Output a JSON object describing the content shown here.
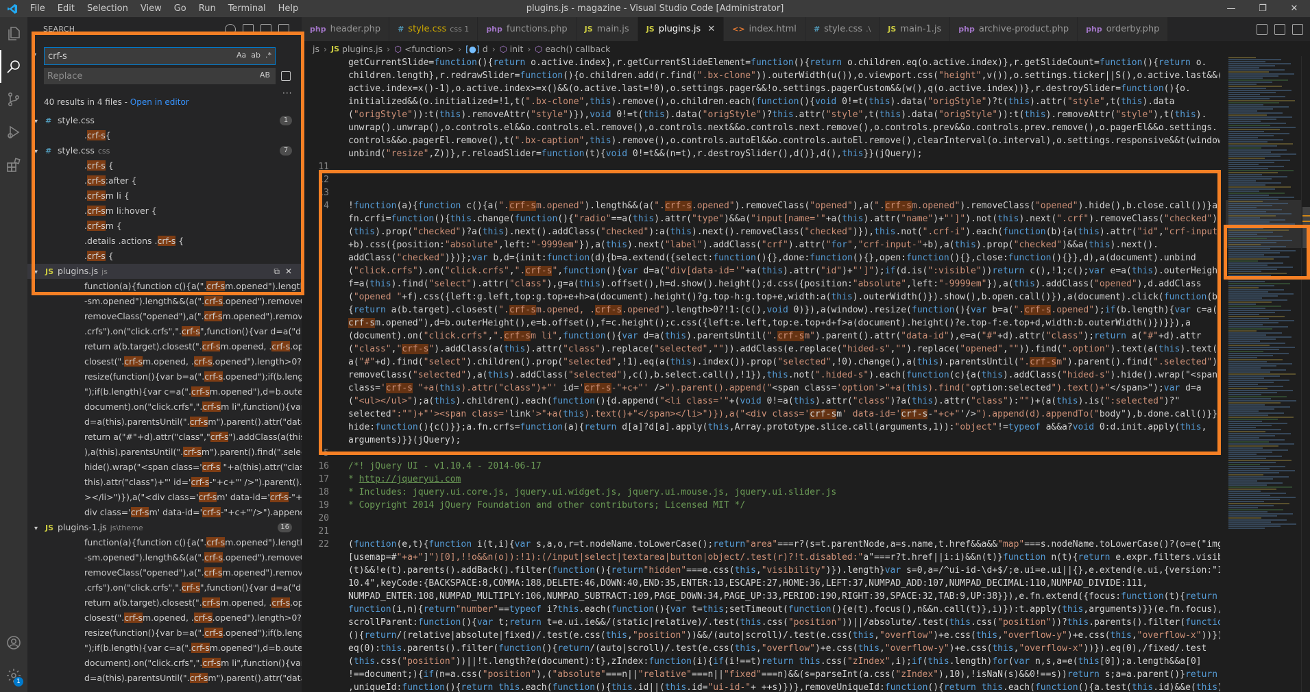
{
  "window": {
    "title": "plugins.js - magazine - Visual Studio Code [Administrator]",
    "menu": [
      "File",
      "Edit",
      "Selection",
      "View",
      "Go",
      "Run",
      "Terminal",
      "Help"
    ],
    "controls": [
      "—",
      "❐",
      "✕"
    ]
  },
  "activity_bar": {
    "items": [
      "files-icon",
      "search-icon",
      "source-control-icon",
      "run-debug-icon",
      "extensions-icon"
    ],
    "bottom": [
      "account-icon",
      "manage-gear-icon"
    ],
    "gear_badge": "1"
  },
  "search": {
    "header": "SEARCH",
    "query": "crf-s",
    "query_options": [
      "Aa",
      "ab",
      ".*"
    ],
    "replace_placeholder": "Replace",
    "replace_option": "AB",
    "summary": "40 results in 4 files - ",
    "open_in_editor": "Open in editor",
    "files": [
      {
        "name": "style.css",
        "type": "css",
        "icon": "#",
        "path": "",
        "count": "1",
        "matches": [
          ".crf-s{"
        ]
      },
      {
        "name": "style.css",
        "type": "css",
        "icon": "#",
        "path": "css",
        "count": "7",
        "matches": [
          ".crf-s {",
          ".crf-s:after {",
          ".crf-sm li {",
          ".crf-sm li:hover {",
          ".crf-sm {",
          ".details .actions .crf-s {",
          ".crf-s {"
        ]
      },
      {
        "name": "plugins.js",
        "type": "js",
        "icon": "JS",
        "path": "js",
        "count": "",
        "matches": [
          "function(a){function c(){a(\".crf-sm.opened\").length&&a(\".crf",
          "-sm.opened\").length&&(a(\".crf-s.opened\").removeClass(\"ope...",
          "removeClass(\"opened\"),a(\".crf-sm.opened\").removeClass(\"op...",
          ".crfs\").on(\"click.crfs\",\".crf-s\",function(){var d=a(\"div[data-id=\"...",
          "return a(b.target).closest(\".crf-sm.opened, .crf-s.opened\").len...",
          "closest(\".crf-sm.opened, .crf-s.opened\").length>0?!1:(c(),void...",
          "resize(function(){var b=a(\".crf-s.opened\");if(b.length){var c=a...",
          "\");if(b.length){var c=a(\".crf-sm.opened\"),d=b.outerHeight(),e...",
          "document).on(\"click.crfs\",\".crf-sm li\",function(){var d=a(this)...",
          "d=a(this).parentsUntil(\".crf-sm\").parent().attr(\"data-id\")=a(\"...",
          "return a(\"#\"+d).attr(\"class\",\"crf-s\").addClass(a(this).attr(\"class...",
          "),a(this).parentsUntil(\".crf-sm\").parent().find(\".selected\").rem...",
          "hide().wrap(\"<span class='crf-s \"+a(this).attr(\"class\")+\"' id='c...",
          "this).attr(\"class\")+\"' id='crf-s-\"+c+\"' />\").parent().append(\"<s...",
          "></li>\")}),a(\"<div class='crf-sm' data-id='crf-s-\"+c+\"'/>\")).ap...",
          "div class='crf-sm' data-id='crf-s-\"+c+\"'/>\").append(d).appen..."
        ]
      },
      {
        "name": "plugins-1.js",
        "type": "js",
        "icon": "JS",
        "path": "js\\theme",
        "count": "16",
        "matches": [
          "function(a){function c(){a(\".crf-sm.opened\").length&&a(\".cr...",
          "-sm.opened\").length&&(a(\".crf-s.opened\").removeClass(\"ope...",
          "removeClass(\"opened\"),a(\".crf-sm.opened\").removeClass(\"op...",
          ".crfs\").on(\"click.crfs\",\".crf-s\",function(){var d=a(\"div[data-id=\"...",
          "return a(b.target).closest(\".crf-sm.opened, .crf-s.opened\").len...",
          "closest(\".crf-sm.opened, .crf-s.opened\").length>0?!1:(c(),void...",
          "resize(function(){var b=a(\".crf-s.opened\");if(b.length){var c=a...",
          "\");if(b.length){var c=a(\".crf-sm.opened\"),d=b.outerHeight(),e...",
          "document).on(\"click.crfs\",\".crf-sm li\",function(){var d=a(this)...",
          "d=a(this).parentsUntil(\".crf-sm\").parent().attr(\"data-id\")=a(\"..."
        ]
      }
    ]
  },
  "tabs": [
    {
      "label": "header.php",
      "type": "php",
      "icon": "php",
      "sub": "",
      "active": false,
      "modified": false
    },
    {
      "label": "style.css",
      "type": "css",
      "icon": "#",
      "sub": "css 1",
      "active": false,
      "modified": true
    },
    {
      "label": "functions.php",
      "type": "php",
      "icon": "php",
      "sub": "",
      "active": false,
      "modified": false
    },
    {
      "label": "main.js",
      "type": "js",
      "icon": "JS",
      "sub": "",
      "active": false,
      "modified": false
    },
    {
      "label": "plugins.js",
      "type": "js",
      "icon": "JS",
      "sub": "",
      "active": true,
      "modified": false
    },
    {
      "label": "index.html",
      "type": "html",
      "icon": "<>",
      "sub": "",
      "active": false,
      "modified": false
    },
    {
      "label": "style.css",
      "type": "css",
      "icon": "#",
      "sub": ".\\",
      "active": false,
      "modified": false
    },
    {
      "label": "main-1.js",
      "type": "js",
      "icon": "JS",
      "sub": "",
      "active": false,
      "modified": false
    },
    {
      "label": "archive-product.php",
      "type": "php",
      "icon": "php",
      "sub": "",
      "active": false,
      "modified": false
    },
    {
      "label": "orderby.php",
      "type": "php",
      "icon": "php",
      "sub": "",
      "active": false,
      "modified": false
    }
  ],
  "breadcrumbs": {
    "folder": "js",
    "file_icon": "JS",
    "file": "plugins.js",
    "items": [
      {
        "icon": "⬡",
        "label": "<function>"
      },
      {
        "icon": "[●]",
        "label": "d"
      },
      {
        "icon": "⬡",
        "label": "init"
      },
      {
        "icon": "⬡",
        "label": "each() callback"
      }
    ]
  },
  "code": {
    "lines": [
      {
        "n": "",
        "t": "getCurrentSlide=function(){return o.active.index},r.getCurrentSlideElement=function(){return o.children.eq(o.active.index)},r.getSlideCount=function(){return o."
      },
      {
        "n": "",
        "t": "children.length},r.redrawSlider=function(){o.children.add(r.find(\".bx-clone\")).outerWidth(u()),o.viewport.css(\"height\",v()),o.settings.ticker||S(),o.active.last&&(o."
      },
      {
        "n": "",
        "t": "active.index=x()-1),o.active.index>=x()&&(o.active.last=!0),o.settings.pager&&!o.settings.pagerCustom&&(w(),q(o.active.index))},r.destroySlider=function(){o."
      },
      {
        "n": "",
        "t": "initialized&&(o.initialized=!1,t(\".bx-clone\",this).remove(),o.children.each(function(){void 0!=t(this).data(\"origStyle\")?t(this).attr(\"style\",t(this).data"
      },
      {
        "n": "",
        "t": "(\"origStyle\")):t(this).removeAttr(\"style\")}),void 0!=t(this).data(\"origStyle\")?this.attr(\"style\",t(this).data(\"origStyle\")):t(this).removeAttr(\"style\"),t(this)."
      },
      {
        "n": "",
        "t": "unwrap().unwrap(),o.controls.el&&o.controls.el.remove(),o.controls.next&&o.controls.next.remove(),o.controls.prev&&o.controls.prev.remove(),o.pagerEl&&o.settings."
      },
      {
        "n": "",
        "t": "controls&&o.pagerEl.remove(),t(\".bx-caption\",this).remove(),o.controls.autoEl&&o.controls.autoEl.remove(),clearInterval(o.interval),o.settings.responsive&&t(window)."
      },
      {
        "n": "",
        "t": "unbind(\"resize\",Z))},r.reloadSlider=function(t){void 0!=t&&(n=t),r.destroySlider(),d()},d(),this}}(jQuery);"
      },
      {
        "n": "11",
        "t": ""
      },
      {
        "n": "12",
        "t": ""
      },
      {
        "n": "13",
        "t": ""
      },
      {
        "n": "4",
        "t": "!function(a){function c(){a(\".crf-sm.opened\").length&&(a(\".crf-s.opened\").removeClass(\"opened\"),a(\".crf-sm.opened\").removeClass(\"opened\").hide(),b.close.call())}a."
      },
      {
        "n": "",
        "t": "fn.crfi=function(){this.change(function(){\"radio\"==a(this).attr(\"type\")&&a(\"input[name='\"+a(this).attr(\"name\")+\"']\").not(this).next(\".crf\").removeClass(\"checked\"),a"
      },
      {
        "n": "",
        "t": "(this).prop(\"checked\")?a(this).next().addClass(\"checked\"):a(this).next().removeClass(\"checked\")}),this.not(\".crf-i\").each(function(b){a(this).attr(\"id\",\"crf-input-\""
      },
      {
        "n": "",
        "t": "+b).css({position:\"absolute\",left:\"-9999em\"}),a(this).next(\"label\").addClass(\"crf\").attr(\"for\",\"crf-input-\"+b),a(this).prop(\"checked\")&&a(this).next()."
      },
      {
        "n": "",
        "t": "addClass(\"checked\")})};var b,d={init:function(d){b=a.extend({select:function(){},done:function(){},open:function(){},close:function(){}},d),a(document).unbind"
      },
      {
        "n": "",
        "t": "(\"click.crfs\").on(\"click.crfs\",\".crf-s\",function(){var d=a(\"div[data-id='\"+a(this).attr(\"id\")+\"']\");if(d.is(\":visible\"))return c(),!1;c();var e=a(this).outerHeight(),"
      },
      {
        "n": "",
        "t": "f=a(this).find(\"select\").attr(\"class\"),g=a(this).offset(),h=d.show().height();d.css({position:\"absolute\",left:\"-9999em\"}),a(this).addClass(\"opened\"),d.addClass"
      },
      {
        "n": "",
        "t": "(\"opened \"+f).css({left:g.left,top:g.top+e+h>a(document).height()?g.top-h:g.top+e,width:a(this).outerWidth()}).show(),b.open.call()}),a(document).click(function(b)"
      },
      {
        "n": "",
        "t": "{return a(b.target).closest(\".crf-sm.opened, .crf-s.opened\").length>0?!1:(c(),void 0)}),a(window).resize(function(){var b=a(\".crf-s.opened\");if(b.length){var c=a(\"."
      },
      {
        "n": "",
        "t": "crf-sm.opened\"),d=b.outerHeight(),e=b.offset(),f=c.height();c.css({left:e.left,top:e.top+d+f>a(document).height()?e.top-f:e.top+d,width:b.outerWidth()})}}),a"
      },
      {
        "n": "",
        "t": "(document).on(\"click.crfs\",\".crf-sm li\",function(){var d=a(this).parentsUntil(\".crf-sm\").parent().attr(\"data-id\"),e=a(\"#\"+d).attr(\"class\");return a(\"#\"+d).attr"
      },
      {
        "n": "",
        "t": "(\"class\",\"crf-s\").addClass(a(this).attr(\"class\").replace(\"selected\",\"\")).addClass(e.replace(\"hided-s\",\"\").replace(\"opened\",\"\")).find(\".option\").text(a(this).text())"
      },
      {
        "n": "",
        "t": "a(\"#\"+d).find(\"select\").children().prop(\"selected\",!1).eq(a(this).index()).prop(\"selected\",!0).change(),a(this).parentsUntil(\".crf-sm\").parent().find(\".selected\")."
      },
      {
        "n": "",
        "t": "removeClass(\"selected\"),a(this).addClass(\"selected\"),c(),b.select.call(),!1}),this.not(\".hided-s\").each(function(c){a(this).addClass(\"hided-s\").hide().wrap(\"<span"
      },
      {
        "n": "",
        "t": "class='crf-s \"+a(this).attr(\"class\")+\"' id='crf-s-\"+c+\"' />\").parent().append(\"<span class='option'>\"+a(this).find(\"option:selected\").text()+\"</span>\");var d=a"
      },
      {
        "n": "",
        "t": "(\"<ul></ul>\");a(this).children().each(function(){d.append(\"<li class='\"+(void 0!=a(this).attr(\"class\")?a(this).attr(\"class\"):\"\")+(a(this).is(\":selected\")?\""
      },
      {
        "n": "",
        "t": "selected\":\"\")+\"'><span class='link'>\"+a(this).text()+\"</span></li>\")}),a(\"<div class='crf-sm' data-id='crf-s-\"+c+\"'/>\").append(d).appendTo(\"body\"),b.done.call()}},"
      },
      {
        "n": "",
        "t": "hide:function(){c()}};a.fn.crfs=function(a){return d[a]?d[a].apply(this,Array.prototype.slice.call(arguments,1)):\"object\"!=typeof a&&a?void 0:d.init.apply(this,"
      },
      {
        "n": "",
        "t": "arguments)}}(jQuery);"
      },
      {
        "n": "5",
        "t": ""
      },
      {
        "n": "16",
        "t": "/*! jQuery UI - v1.10.4 - 2014-06-17"
      },
      {
        "n": "17",
        "t": "* http://jqueryui.com"
      },
      {
        "n": "18",
        "t": "* Includes: jquery.ui.core.js, jquery.ui.widget.js, jquery.ui.mouse.js, jquery.ui.slider.js"
      },
      {
        "n": "19",
        "t": "* Copyright 2014 jQuery Foundation and other contributors; Licensed MIT */"
      },
      {
        "n": "20",
        "t": ""
      },
      {
        "n": "21",
        "t": ""
      },
      {
        "n": "22",
        "t": "(function(e,t){function i(t,i){var s,a,o,r=t.nodeName.toLowerCase();return\"area\"===r?(s=t.parentNode,a=s.name,t.href&&a&&\"map\"===s.nodeName.toLowerCase()?(o=e(\"img"
      },
      {
        "n": "",
        "t": "[usemap=#\"+a+\"]\")[0],!!o&&n(o)):!1):(/input|select|textarea|button|object/.test(r)?!t.disabled:\"a\"===r?t.href||i:i)&&n(t)}function n(t){return e.expr.filters.visible"
      },
      {
        "n": "",
        "t": "(t)&&!e(t).parents().addBack().filter(function(){return\"hidden\"===e.css(this,\"visibility\")}).length}var s=0,a=/^ui-id-\\d+$/;e.ui=e.ui||{},e.extend(e.ui,{version:\"1."
      },
      {
        "n": "",
        "t": "10.4\",keyCode:{BACKSPACE:8,COMMA:188,DELETE:46,DOWN:40,END:35,ENTER:13,ESCAPE:27,HOME:36,LEFT:37,NUMPAD_ADD:107,NUMPAD_DECIMAL:110,NUMPAD_DIVIDE:111,"
      },
      {
        "n": "",
        "t": "NUMPAD_ENTER:108,NUMPAD_MULTIPLY:106,NUMPAD_SUBTRACT:109,PAGE_DOWN:34,PAGE_UP:33,PERIOD:190,RIGHT:39,SPACE:32,TAB:9,UP:38}}),e.fn.extend({focus:function(t){return"
      },
      {
        "n": "",
        "t": "function(i,n){return\"number\"==typeof i?this.each(function(){var t=this;setTimeout(function(){e(t).focus(),n&&n.call(t)},i)}):t.apply(this,arguments)}}(e.fn.focus),"
      },
      {
        "n": "",
        "t": "scrollParent:function(){var t;return t=e.ui.ie&&/(static|relative)/.test(this.css(\"position\"))||/absolute/.test(this.css(\"position\"))?this.parents().filter(function"
      },
      {
        "n": "",
        "t": "(){return/(relative|absolute|fixed)/.test(e.css(this,\"position\"))&&/(auto|scroll)/.test(e.css(this,\"overflow\")+e.css(this,\"overflow-y\")+e.css(this,\"overflow-x\"))})."
      },
      {
        "n": "",
        "t": "eq(0):this.parents().filter(function(){return/(auto|scroll)/.test(e.css(this,\"overflow\")+e.css(this,\"overflow-y\")+e.css(this,\"overflow-x\"))}).eq(0),/fixed/.test"
      },
      {
        "n": "",
        "t": "(this.css(\"position\"))||!t.length?e(document):t},zIndex:function(i){if(i!==t)return this.css(\"zIndex\",i);if(this.length)for(var n,s,a=e(this[0]);a.length&&a[0]"
      },
      {
        "n": "",
        "t": "!==document;){if(n=a.css(\"position\"),(\"absolute\"===n||\"relative\"===n||\"fixed\"===n)&&(s=parseInt(a.css(\"zIndex\"),10),!isNaN(s)&&0!==s))return s;a=a.parent()}return 0}"
      },
      {
        "n": "",
        "t": ",uniqueId:function(){return this.each(function(){this.id||(this.id=\"ui-id-\"+ ++s)})},removeUniqueId:function(){return this.each(function(){a.test(this.id)&&e(this).r"
      }
    ]
  },
  "colors": {
    "annotation": "#f58025",
    "match_highlight": "#ea5c00",
    "accent": "#007acc"
  }
}
